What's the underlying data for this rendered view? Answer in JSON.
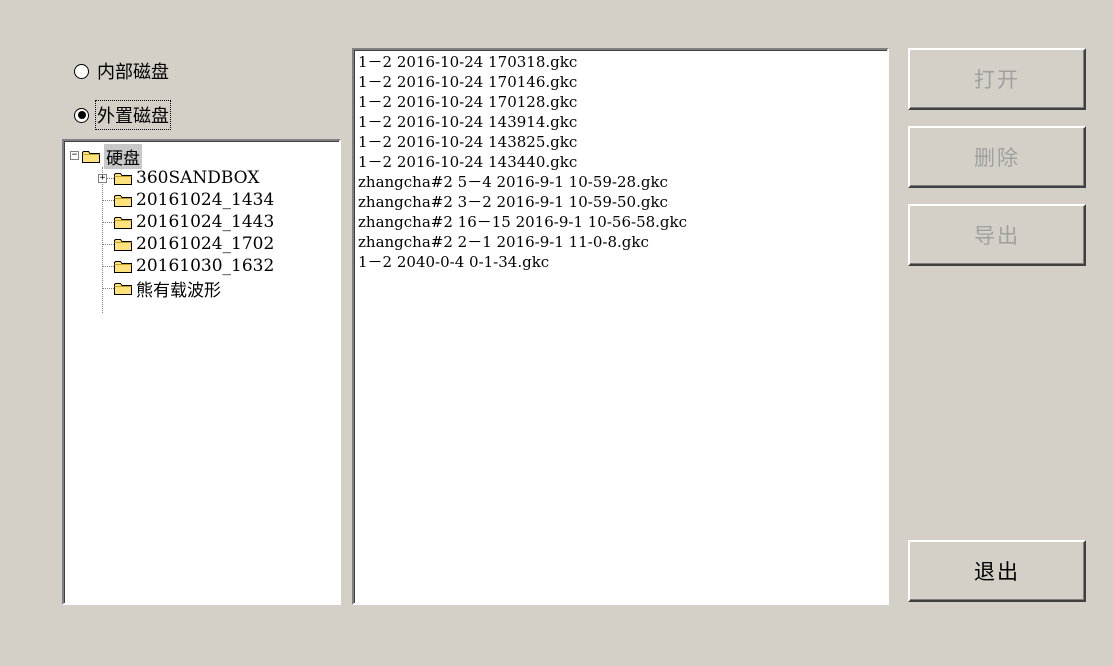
{
  "storage": {
    "internal_label": "内部磁盘",
    "external_label": "外置磁盘",
    "selected": "external"
  },
  "tree": {
    "root": "硬盘",
    "children": [
      "360SANDBOX",
      "20161024_1434",
      "20161024_1443",
      "20161024_1702",
      "20161030_1632",
      "熊有载波形"
    ]
  },
  "files": [
    "1－2 2016-10-24 170318.gkc",
    "1－2 2016-10-24 170146.gkc",
    "1－2 2016-10-24 170128.gkc",
    "1－2 2016-10-24 143914.gkc",
    "1－2 2016-10-24 143825.gkc",
    "1－2 2016-10-24 143440.gkc",
    "zhangcha#2 5－4 2016-9-1 10-59-28.gkc",
    "zhangcha#2 3－2 2016-9-1 10-59-50.gkc",
    "zhangcha#2 16－15 2016-9-1 10-56-58.gkc",
    "zhangcha#2 2－1 2016-9-1 11-0-8.gkc",
    "1－2 2040-0-4 0-1-34.gkc"
  ],
  "buttons": {
    "open": "打开",
    "delete": "删除",
    "export": "导出",
    "exit": "退出"
  },
  "icons": [
    "folder-icon",
    "expand-icon",
    "collapse-icon"
  ]
}
